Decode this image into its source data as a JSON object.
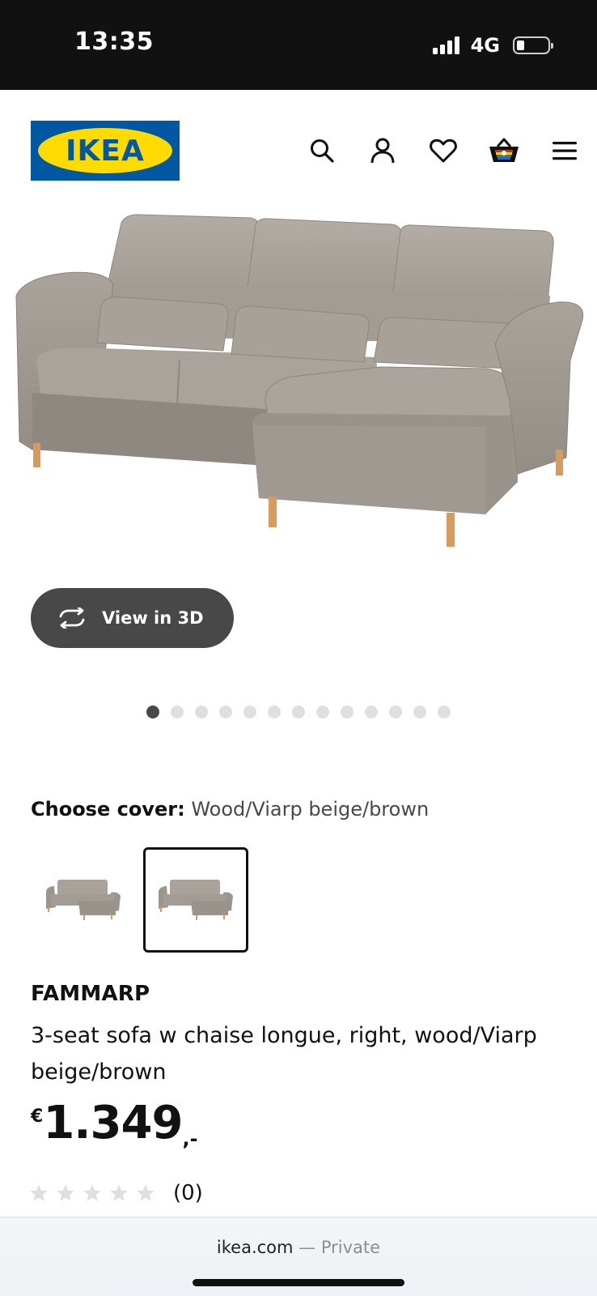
{
  "status_bar": {
    "time": "13:35",
    "network": "4G"
  },
  "header": {
    "logo_text": "IKEA",
    "icons": [
      "search-icon",
      "account-icon",
      "heart-icon",
      "basket-icon",
      "menu-icon"
    ]
  },
  "gallery": {
    "view_3d_label": "View in 3D",
    "image_count": 13,
    "active_index": 0
  },
  "cover": {
    "label": "Choose cover:",
    "value": "Wood/Viarp beige/brown",
    "swatches_count": 2,
    "selected_index": 1
  },
  "product": {
    "name": "FAMMARP",
    "description": "3-seat sofa w chaise longue, right, wood/Viarp beige/brown",
    "price_currency": "€",
    "price_integer": "1.349",
    "price_suffix": ",-",
    "rating_stars": 0,
    "rating_max": 5,
    "rating_count": "(0)"
  },
  "browser": {
    "domain": "ikea.com",
    "mode": " — Private"
  },
  "colors": {
    "ikea_blue": "#0058a3",
    "ikea_yellow": "#ffdb00",
    "button_dark": "#484848",
    "sofa_fabric": "#a29b93",
    "sofa_legs": "#d79b5c"
  }
}
